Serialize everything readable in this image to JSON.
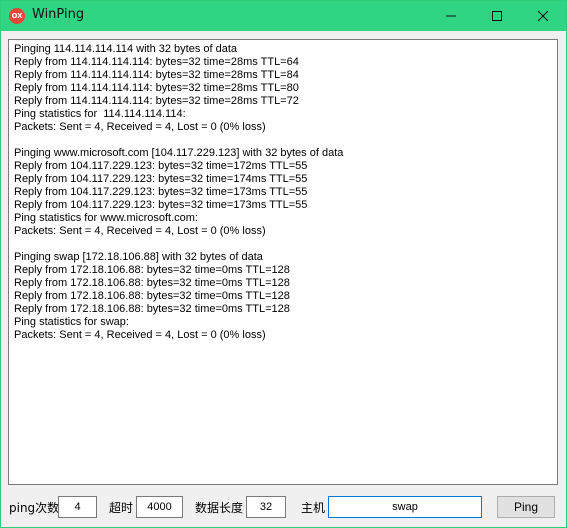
{
  "window": {
    "title": "WinPing",
    "icon_text": "OX",
    "icon": "winping-app-icon",
    "accent_color": "#2fd582",
    "controls": [
      "minimize-icon",
      "maximize-icon",
      "close-icon"
    ]
  },
  "output": {
    "lines": [
      "Pinging 114.114.114.114 with 32 bytes of data",
      "Reply from 114.114.114.114: bytes=32 time=28ms TTL=64",
      "Reply from 114.114.114.114: bytes=32 time=28ms TTL=84",
      "Reply from 114.114.114.114: bytes=32 time=28ms TTL=80",
      "Reply from 114.114.114.114: bytes=32 time=28ms TTL=72",
      "Ping statistics for  114.114.114.114:",
      "Packets: Sent = 4, Received = 4, Lost = 0 (0% loss)",
      "",
      "Pinging www.microsoft.com [104.117.229.123] with 32 bytes of data",
      "Reply from 104.117.229.123: bytes=32 time=172ms TTL=55",
      "Reply from 104.117.229.123: bytes=32 time=174ms TTL=55",
      "Reply from 104.117.229.123: bytes=32 time=173ms TTL=55",
      "Reply from 104.117.229.123: bytes=32 time=173ms TTL=55",
      "Ping statistics for www.microsoft.com:",
      "Packets: Sent = 4, Received = 4, Lost = 0 (0% loss)",
      "",
      "Pinging swap [172.18.106.88] with 32 bytes of data",
      "Reply from 172.18.106.88: bytes=32 time=0ms TTL=128",
      "Reply from 172.18.106.88: bytes=32 time=0ms TTL=128",
      "Reply from 172.18.106.88: bytes=32 time=0ms TTL=128",
      "Reply from 172.18.106.88: bytes=32 time=0ms TTL=128",
      "Ping statistics for swap:",
      "Packets: Sent = 4, Received = 4, Lost = 0 (0% loss)"
    ]
  },
  "controls": {
    "count_label": "ping次数",
    "count_value": "4",
    "timeout_label": "超时",
    "timeout_value": "4000",
    "size_label": "数据长度",
    "size_value": "32",
    "host_label": "主机",
    "host_value": "swap",
    "ping_button": "Ping"
  }
}
